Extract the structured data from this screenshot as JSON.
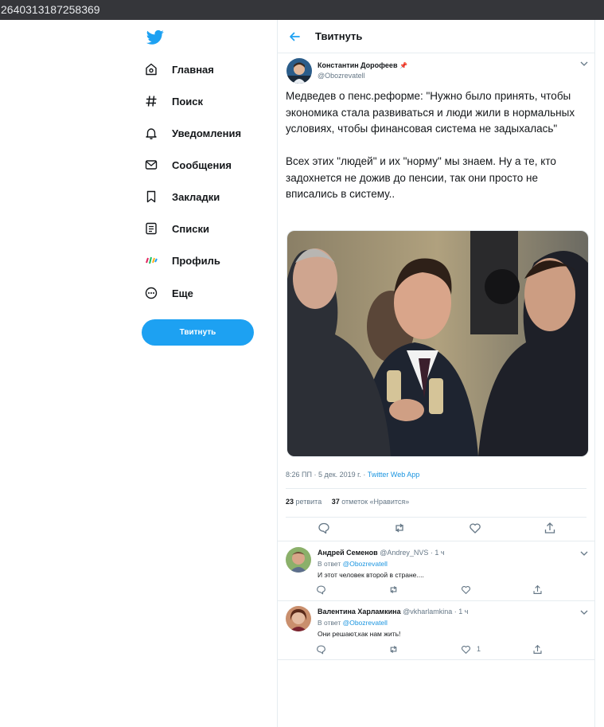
{
  "browser": {
    "address_text": "2640313187258369"
  },
  "sidebar": {
    "items": [
      {
        "label": "Главная",
        "icon": "home-icon"
      },
      {
        "label": "Поиск",
        "icon": "hashtag-icon"
      },
      {
        "label": "Уведомления",
        "icon": "bell-icon"
      },
      {
        "label": "Сообщения",
        "icon": "envelope-icon"
      },
      {
        "label": "Закладки",
        "icon": "bookmark-icon"
      },
      {
        "label": "Списки",
        "icon": "list-icon"
      },
      {
        "label": "Профиль",
        "icon": "profile-avatar-icon"
      },
      {
        "label": "Еще",
        "icon": "more-circle-icon"
      }
    ],
    "tweet_button_label": "Твитнуть"
  },
  "header": {
    "title": "Твитнуть"
  },
  "tweet": {
    "author_name": "Константин Дорофеев",
    "author_handle": "@Obozrevatell",
    "text": "Медведев о пенс.реформе: \"Нужно было принять, чтобы экономика стала развиваться и люди жили в нормальных условиях, чтобы финансовая система не задыхалась\"\n\nВсех этих \"людей\" и их \"норму\" мы знаем. Ну а те, кто задохнется не дожив до пенсии, так они просто не вписались в систему..",
    "time_date": "8:26 ПП · 5 дек. 2019 г. · ",
    "source": "Twitter Web App",
    "retweets_count": "23",
    "retweets_label": "ретвита",
    "likes_count": "37",
    "likes_label": "отметок «Нравится»"
  },
  "replies": [
    {
      "name": "Андрей Семенов",
      "handle_time": "@Andrey_NVS · 1 ч",
      "reply_to_prefix": "В ответ ",
      "reply_to_handle": "@Obozrevatell",
      "text": "И этот человек второй в стране....",
      "like_count": ""
    },
    {
      "name": "Валентина Харламкина",
      "handle_time": "@vkharlamkina · 1 ч",
      "reply_to_prefix": "В ответ ",
      "reply_to_handle": "@Obozrevatell",
      "text": "Они решают,как нам жить!",
      "like_count": "1"
    }
  ],
  "colors": {
    "accent": "#1da1f2",
    "link": "#1b95e0",
    "muted": "#657786",
    "border": "#e6ecf0"
  }
}
